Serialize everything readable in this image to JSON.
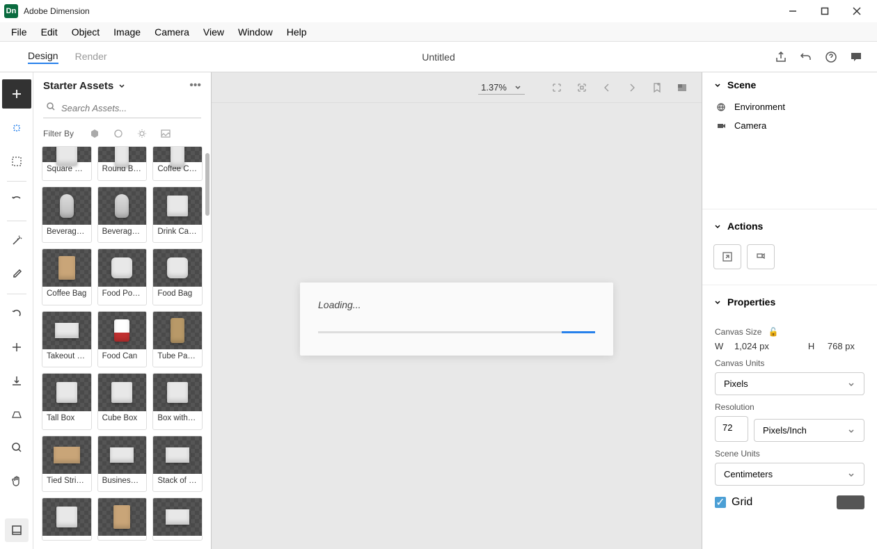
{
  "titlebar": {
    "app_name": "Adobe Dimension"
  },
  "menubar": [
    "File",
    "Edit",
    "Object",
    "Image",
    "Camera",
    "View",
    "Window",
    "Help"
  ],
  "modes": {
    "design": "Design",
    "render": "Render"
  },
  "doc_title": "Untitled",
  "assets": {
    "panel_title": "Starter Assets",
    "search_placeholder": "Search Assets...",
    "filter_label": "Filter By",
    "items": [
      {
        "label": "Square Bo...",
        "shape": "box",
        "partial": true
      },
      {
        "label": "Round Bo...",
        "shape": "cyl",
        "partial": true
      },
      {
        "label": "Coffee Cup",
        "shape": "cyl",
        "partial": true
      },
      {
        "label": "Beverage ...",
        "shape": "can"
      },
      {
        "label": "Beverage ...",
        "shape": "can"
      },
      {
        "label": "Drink Cart...",
        "shape": "box"
      },
      {
        "label": "Coffee Bag",
        "shape": "bag"
      },
      {
        "label": "Food Pouch",
        "shape": "pouch"
      },
      {
        "label": "Food Bag",
        "shape": "pouch"
      },
      {
        "label": "Takeout Box",
        "shape": "flat"
      },
      {
        "label": "Food Can",
        "shape": "cup"
      },
      {
        "label": "Tube Pack...",
        "shape": "tube"
      },
      {
        "label": "Tall Box",
        "shape": "box"
      },
      {
        "label": "Cube Box",
        "shape": "box"
      },
      {
        "label": "Box with O...",
        "shape": "box"
      },
      {
        "label": "Tied String...",
        "shape": "parcel"
      },
      {
        "label": "Business C...",
        "shape": "flat"
      },
      {
        "label": "Stack of Ca...",
        "shape": "flat"
      },
      {
        "label": "",
        "shape": "box",
        "nolabel": true
      },
      {
        "label": "",
        "shape": "bag",
        "nolabel": true
      },
      {
        "label": "",
        "shape": "flat",
        "nolabel": true
      }
    ]
  },
  "canvas": {
    "zoom": "1.37%",
    "loading_text": "Loading...",
    "scene_section": "Scene",
    "scene_rows": [
      "Environment",
      "Camera"
    ],
    "actions_section": "Actions",
    "properties_section": "Properties",
    "canvas_size_label": "Canvas Size",
    "width_label": "W",
    "width_value": "1,024 px",
    "height_label": "H",
    "height_value": "768 px",
    "canvas_units_label": "Canvas Units",
    "canvas_units_value": "Pixels",
    "resolution_label": "Resolution",
    "resolution_value": "72",
    "resolution_units": "Pixels/Inch",
    "scene_units_label": "Scene Units",
    "scene_units_value": "Centimeters",
    "grid_label": "Grid"
  }
}
